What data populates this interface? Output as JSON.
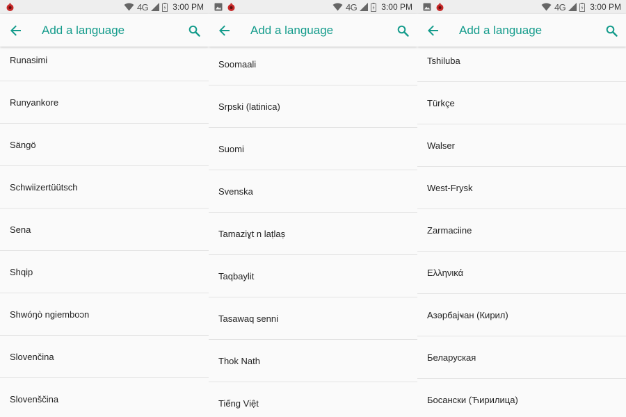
{
  "status": {
    "time": "3:00 PM",
    "network": "4G"
  },
  "appbar": {
    "title": "Add a language"
  },
  "colors": {
    "accent": "#139b8b",
    "status_bg": "#eeeeee",
    "divider": "#e3e3e3"
  },
  "icons": {
    "back": "arrow-back-icon",
    "search": "search-icon"
  },
  "panels": [
    {
      "languages": [
        "Runasimi",
        "Runyankore",
        "Sängö",
        "Schwiizertüütsch",
        "Sena",
        "Shqip",
        "Shwóŋò ngiemboɔn",
        "Slovenčina",
        "Slovenščina"
      ]
    },
    {
      "languages": [
        "Soomaali",
        "Srpski (latinica)",
        "Suomi",
        "Svenska",
        "Tamaziɣt n laṭlaṣ",
        "Taqbaylit",
        "Tasawaq senni",
        "Thok Nath",
        "Tiếng Việt"
      ]
    },
    {
      "languages": [
        "Tshiluba",
        "Türkçe",
        "Walser",
        "West-Frysk",
        "Zarmaciine",
        "Ελληνικά",
        "Азәрбајҹан (Кирил)",
        "Беларуская",
        "Босански (Ћирилица)"
      ]
    }
  ]
}
